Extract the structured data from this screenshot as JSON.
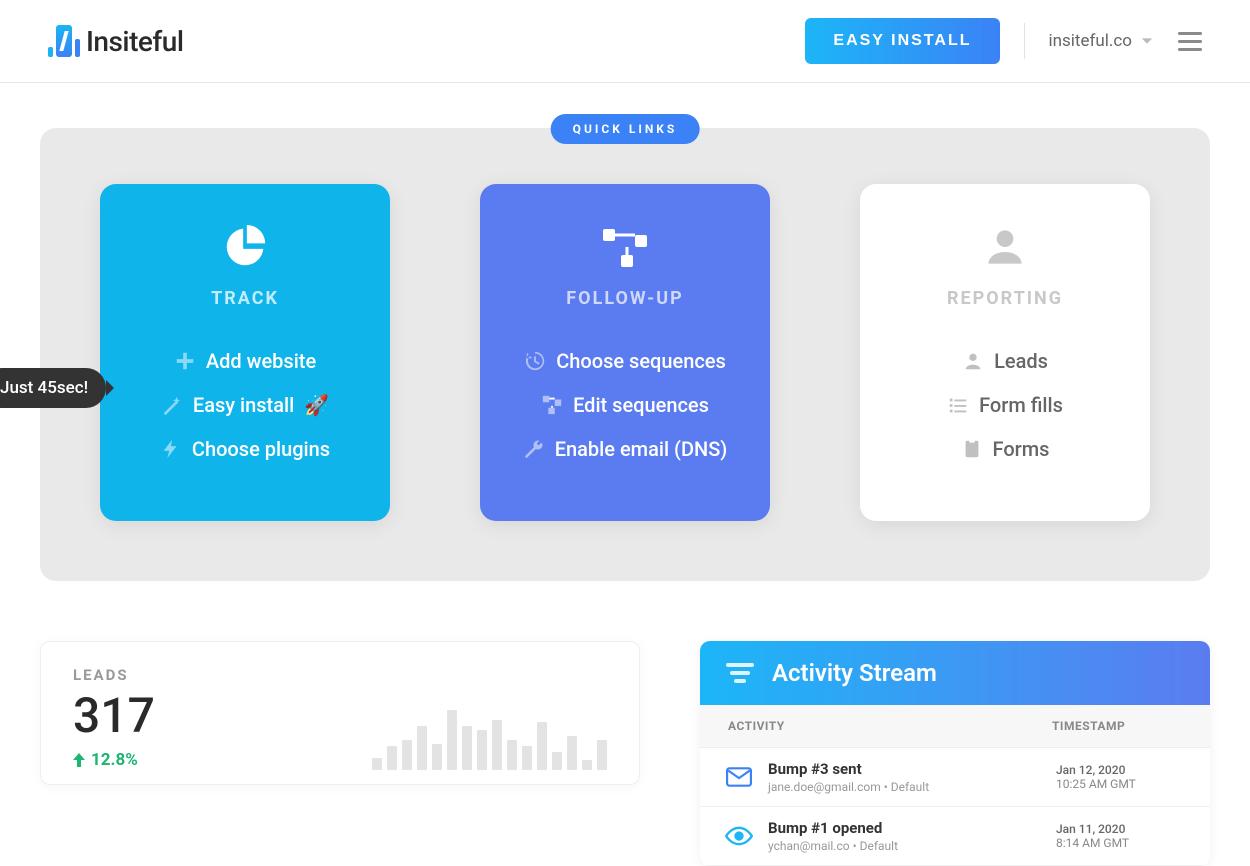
{
  "header": {
    "brand": "Insiteful",
    "easy_install_button": "EASY INSTALL",
    "site_label": "insiteful.co"
  },
  "quick_links": {
    "badge": "QUICK LINKS",
    "cards": [
      {
        "title": "TRACK",
        "links": [
          {
            "icon": "plus-icon",
            "label": "Add website"
          },
          {
            "icon": "wand-icon",
            "label": "Easy install",
            "emoji": "🚀"
          },
          {
            "icon": "bolt-icon",
            "label": "Choose plugins"
          }
        ],
        "tooltip": "Just 45sec!"
      },
      {
        "title": "FOLLOW-UP",
        "links": [
          {
            "icon": "history-icon",
            "label": "Choose sequences"
          },
          {
            "icon": "flow-icon",
            "label": "Edit sequences"
          },
          {
            "icon": "wrench-icon",
            "label": "Enable email (DNS)"
          }
        ]
      },
      {
        "title": "REPORTING",
        "links": [
          {
            "icon": "user-icon",
            "label": "Leads"
          },
          {
            "icon": "checklist-icon",
            "label": "Form fills"
          },
          {
            "icon": "clipboard-icon",
            "label": "Forms"
          }
        ]
      }
    ]
  },
  "leads": {
    "label": "LEADS",
    "count": "317",
    "change": "12.8%",
    "spark": [
      12,
      24,
      30,
      44,
      26,
      60,
      44,
      40,
      50,
      30,
      24,
      48,
      18,
      34,
      10,
      30
    ]
  },
  "activity": {
    "title": "Activity Stream",
    "col_activity": "ACTIVITY",
    "col_timestamp": "TIMESTAMP",
    "rows": [
      {
        "icon": "envelope-icon",
        "title": "Bump #3 sent",
        "sub": "jane.doe@gmail.com • Default",
        "date": "Jan 12, 2020",
        "time": "10:25 AM GMT"
      },
      {
        "icon": "eye-icon",
        "title": "Bump #1 opened",
        "sub": "ychan@mail.co • Default",
        "date": "Jan 11, 2020",
        "time": "8:14 AM GMT"
      }
    ]
  }
}
